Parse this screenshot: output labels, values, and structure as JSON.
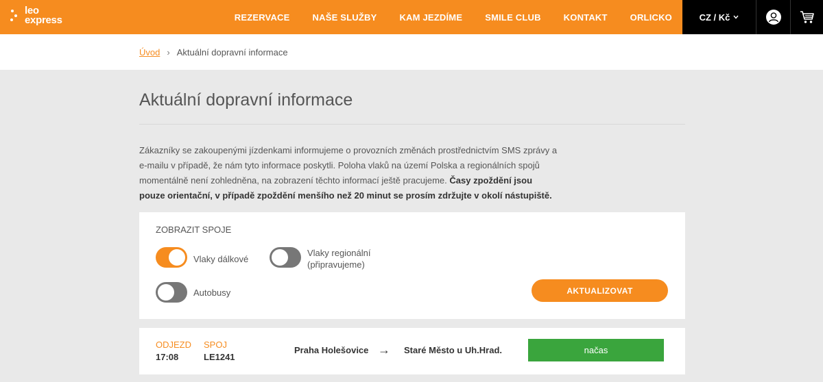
{
  "brand": {
    "line1": "leo",
    "line2": "express"
  },
  "nav": [
    "REZERVACE",
    "NAŠE SLUŽBY",
    "KAM JEZDÍME",
    "SMILE CLUB",
    "KONTAKT",
    "ORLICKO"
  ],
  "lang": "CZ / Kč",
  "breadcrumb": {
    "home": "Úvod",
    "separator": "›",
    "current": "Aktuální dopravní informace"
  },
  "title": "Aktuální dopravní informace",
  "intro": {
    "text": "Zákazníky se zakoupenými jízdenkami informujeme o provozních změnách prostřednictvím SMS zprávy a e-mailu v případě, že nám tyto informace poskytli. Poloha vlaků na území Polska a regionálních spojů momentálně není zohledněna, na zobrazení těchto informací ještě pracujeme. ",
    "bold": "Časy zpoždění jsou pouze orientační, v případě zpoždění menšího než 20 minut se prosím zdržujte v okolí nástupiště."
  },
  "filter": {
    "heading": "ZOBRAZIT SPOJE",
    "long_distance": {
      "label": "Vlaky dálkové",
      "on": true
    },
    "regional": {
      "label": "Vlaky regionální",
      "sub": "(připravujeme)",
      "on": false
    },
    "buses": {
      "label": "Autobusy",
      "on": false
    },
    "update_label": "AKTUALIZOVAT"
  },
  "departures": [
    {
      "departure_head": "ODJEZD",
      "departure": "17:08",
      "connection_head": "SPOJ",
      "connection": "LE1241",
      "from": "Praha Holešovice",
      "arrow": "→",
      "to": "Staré Město u Uh.Hrad.",
      "status": "načas"
    }
  ],
  "colors": {
    "accent": "#f68c1f",
    "ontime": "#3aa53d",
    "dark": "#000000"
  }
}
